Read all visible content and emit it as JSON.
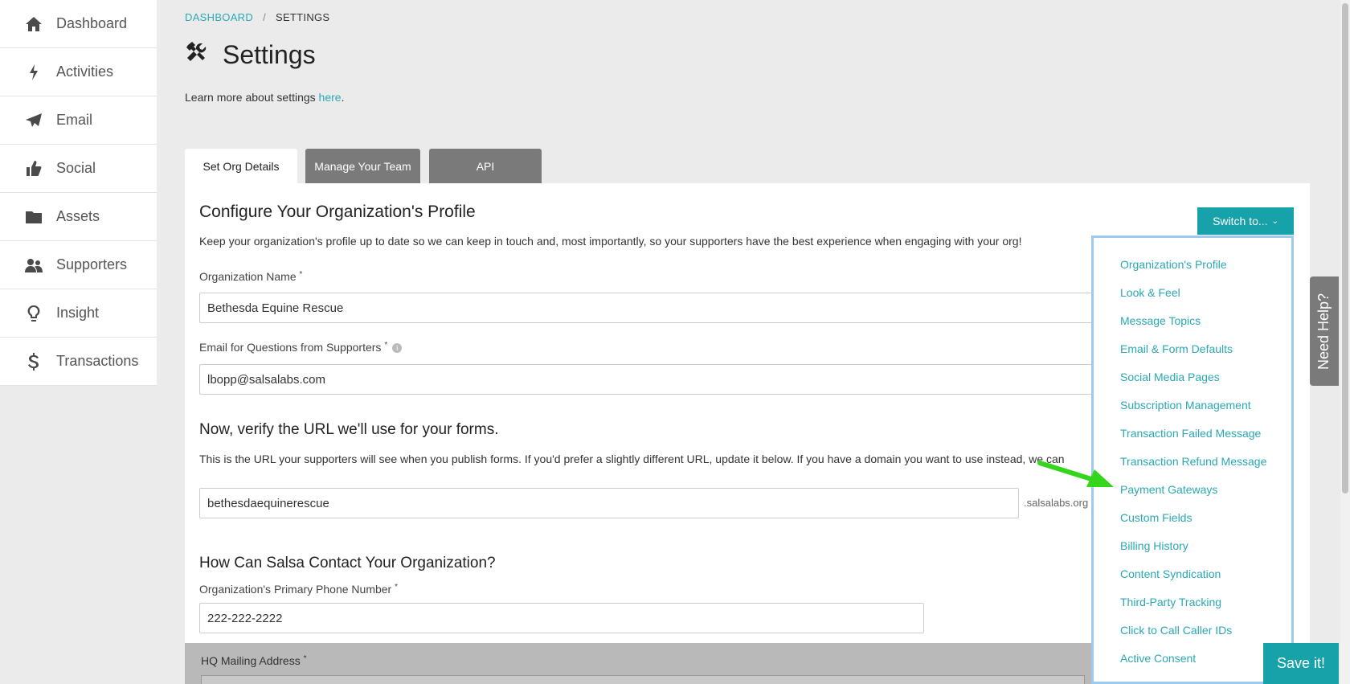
{
  "sidebar": {
    "items": [
      {
        "label": "Dashboard",
        "icon": "home-icon"
      },
      {
        "label": "Activities",
        "icon": "bolt-icon"
      },
      {
        "label": "Email",
        "icon": "paper-plane-icon"
      },
      {
        "label": "Social",
        "icon": "thumbs-up-icon"
      },
      {
        "label": "Assets",
        "icon": "folder-icon"
      },
      {
        "label": "Supporters",
        "icon": "users-icon"
      },
      {
        "label": "Insight",
        "icon": "lightbulb-icon"
      },
      {
        "label": "Transactions",
        "icon": "dollar-icon"
      }
    ]
  },
  "breadcrumb": {
    "root": "DASHBOARD",
    "separator": "/",
    "current": "SETTINGS"
  },
  "page": {
    "title": "Settings",
    "title_icon": "tools-icon",
    "learn_prefix": "Learn more about settings ",
    "learn_link": "here",
    "learn_suffix": "."
  },
  "tabs": [
    {
      "label": "Set Org Details",
      "active": true
    },
    {
      "label": "Manage Your Team",
      "active": false
    },
    {
      "label": "API",
      "active": false
    }
  ],
  "profile": {
    "heading": "Configure Your Organization's Profile",
    "description": "Keep your organization's profile up to date so we can keep in touch and, most importantly, so your supporters have the best experience when engaging with your org!",
    "org_name_label": "Organization Name",
    "org_name_value": "Bethesda Equine Rescue",
    "email_label": "Email for Questions from Supporters",
    "email_value": "lbopp@salsalabs.com",
    "required_mark": "*"
  },
  "url_section": {
    "heading": "Now, verify the URL we'll use for your forms.",
    "description": "This is the URL your supporters will see when you publish forms. If you'd prefer a slightly different URL, update it below. If you have a domain you want to use instead, we can",
    "url_value": "bethesdaequinerescue",
    "url_suffix": ".salsalabs.org"
  },
  "contact": {
    "heading": "How Can Salsa Contact Your Organization?",
    "phone_label": "Organization's Primary Phone Number",
    "phone_value": "222-222-2222",
    "address_label": "HQ Mailing Address"
  },
  "switch_menu": {
    "button_label": "Switch to...",
    "items": [
      "Organization's Profile",
      "Look & Feel",
      "Message Topics",
      "Email & Form Defaults",
      "Social Media Pages",
      "Subscription Management",
      "Transaction Failed Message",
      "Transaction Refund Message",
      "Payment Gateways",
      "Custom Fields",
      "Billing History",
      "Content Syndication",
      "Third-Party Tracking",
      "Click to Call Caller IDs",
      "Active Consent"
    ]
  },
  "help_tab": "Need Help?",
  "save_button": "Save it!",
  "colors": {
    "accent": "#17a2a9",
    "link": "#2aa8b4",
    "annotation_arrow": "#33d61a"
  }
}
